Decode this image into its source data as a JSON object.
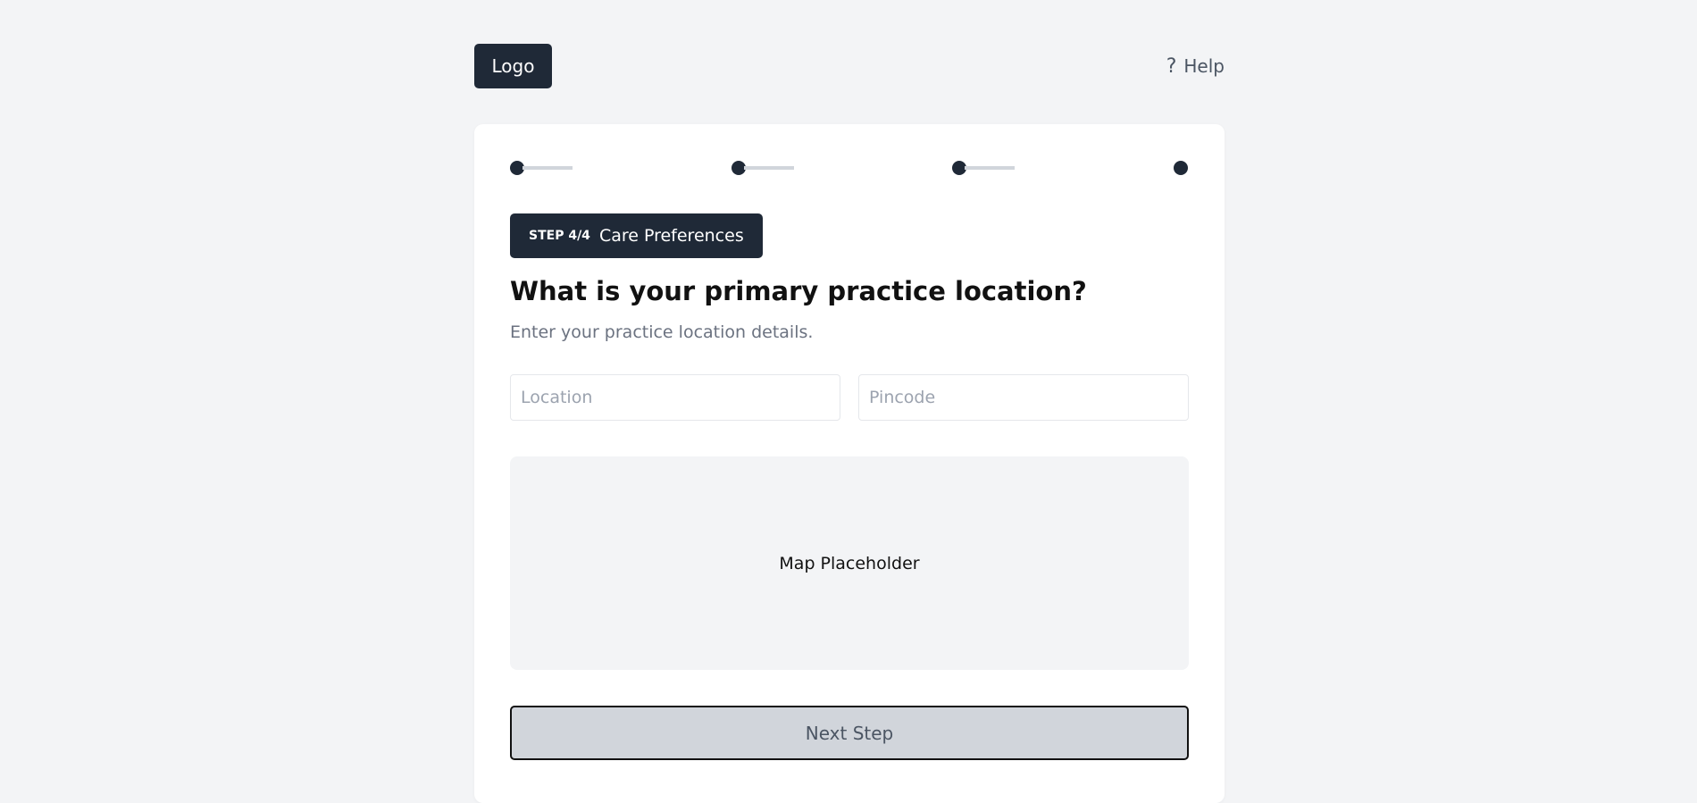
{
  "header": {
    "logo_label": "Logo",
    "help_icon": "?",
    "help_label": "Help"
  },
  "progress": {
    "total_steps": 4,
    "current_step": 4
  },
  "step_badge": {
    "step_label": "STEP 4/4",
    "step_name": "Care Preferences"
  },
  "question": {
    "title": "What is your primary practice location?",
    "subtitle": "Enter your practice location details."
  },
  "fields": {
    "location_placeholder": "Location",
    "location_value": "",
    "pincode_placeholder": "Pincode",
    "pincode_value": ""
  },
  "map": {
    "label": "Map Placeholder"
  },
  "actions": {
    "next_label": "Next Step"
  },
  "colors": {
    "background": "#f3f4f6",
    "primary_dark": "#1f2937",
    "progress_track": "#d1d5db",
    "muted_text": "#6b7280",
    "button_disabled": "#d1d5db"
  }
}
